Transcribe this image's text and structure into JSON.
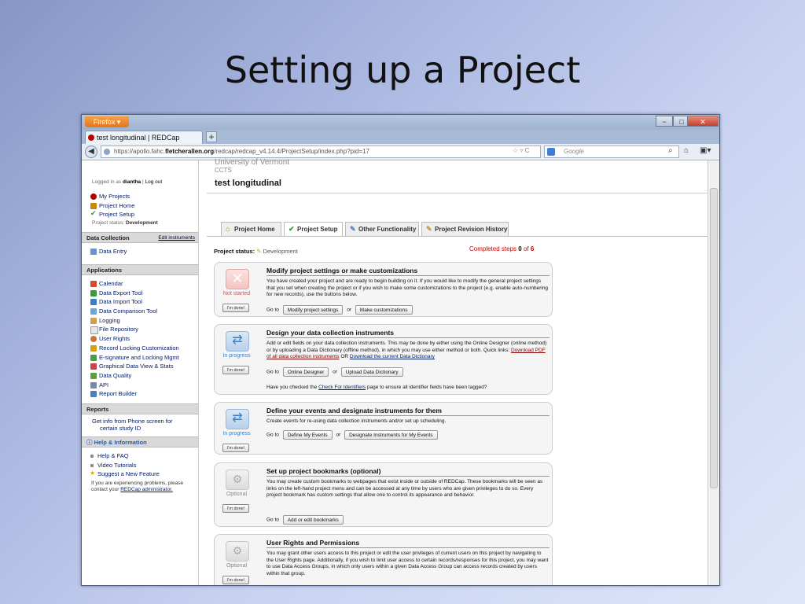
{
  "slide": {
    "title": "Setting up a Project"
  },
  "browser": {
    "menu_button": "Firefox ▾",
    "tab_title": "test longitudinal | REDCap",
    "url_prefix": "https://apollo.fahc.",
    "url_domain": "fletcherallen.org",
    "url_suffix": "/redcap/redcap_v4.14.4/ProjectSetup/index.php?pid=17",
    "search_placeholder": "Google",
    "minimize": "−",
    "maximize": "□",
    "close": "✕"
  },
  "sidebar": {
    "logged_in_prefix": "Logged in as",
    "username": "diantha",
    "logout": "Log out",
    "links": [
      {
        "label": "My Projects",
        "color": "#b00000"
      },
      {
        "label": "Project Home",
        "color": "#cc8800"
      },
      {
        "label": "Project Setup",
        "color": "#2e9e2e"
      }
    ],
    "status_label": "Project status:",
    "status_value": "Development",
    "data_collection": {
      "title": "Data Collection",
      "edit_link": "Edit instruments",
      "items": [
        "Data Entry"
      ]
    },
    "applications": {
      "title": "Applications",
      "items": [
        "Calendar",
        "Data Export Tool",
        "Data Import Tool",
        "Data Comparison Tool",
        "Logging",
        "File Repository",
        "User Rights",
        "Record Locking Customization",
        "E-signature and Locking Mgmt",
        "Graphical Data View & Stats",
        "Data Quality",
        "API",
        "Report Builder"
      ]
    },
    "reports": {
      "title": "Reports",
      "item_line1": "Get info from Phone screen for",
      "item_line2": "certain study ID"
    },
    "help": {
      "title": "Help & Information",
      "items": [
        "Help & FAQ",
        "Video Tutorials",
        "Suggest a New Feature"
      ],
      "note_line1": "If you are experiencing problems, please",
      "note_line2_prefix": "contact your",
      "note_link": "REDCap administrator."
    }
  },
  "main": {
    "institution": "University of Vermont",
    "dept": "CCTS",
    "project_title": "test longitudinal",
    "tabs": [
      "Project Home",
      "Project Setup",
      "Other Functionality",
      "Project Revision History"
    ],
    "status_label": "Project status:",
    "status_value": "Development",
    "completed_prefix": "Completed steps",
    "completed_done": "0",
    "completed_of": "of",
    "completed_total": "6",
    "goto": "Go to",
    "or": "or",
    "done_btn": "I'm done!",
    "steps": [
      {
        "title": "Modify project settings or make customizations",
        "state": "Not started",
        "desc": "You have created your project and are ready to begin building on it. If you would like to modify the general project settings that you set when creating the project or if you wish to make some customizations to the project (e.g. enable auto-numbering for new records), use the buttons below.",
        "btn1": "Modify project settings",
        "btn2": "Make customizations"
      },
      {
        "title": "Design your data collection instruments",
        "state": "In progress",
        "desc": "Add or edit fields on your data collection instruments. This may be done by either using the Online Designer (online method) or by uploading a Data Dictionary (offline method), in which you may use either method or both. Quick links:",
        "link1": "Download PDF of all data collection instruments",
        "link_or": "OR",
        "link2": "Download the current Data Dictionary",
        "btn1": "Online Designer",
        "btn2": "Upload Data Dictionary",
        "check_prefix": "Have you checked the",
        "check_link": "Check For Identifiers",
        "check_suffix": "page to ensure all identifier fields have been tagged?"
      },
      {
        "title": "Define your events and designate instruments for them",
        "state": "In progress",
        "desc": "Create events for re-using data collection instruments and/or set up scheduling.",
        "btn1": "Define My Events",
        "btn2": "Designate Instruments for My Events"
      },
      {
        "title": "Set up project bookmarks (optional)",
        "state": "Optional",
        "desc": "You may create custom bookmarks to webpages that exist inside or outside of REDCap. These bookmarks will be seen as links on the left-hand project menu and can be accessed at any time by users who are given privileges to do so. Every project bookmark has custom settings that allow one to control its appearance and behavior.",
        "btn1": "Add or edit bookmarks"
      },
      {
        "title": "User Rights and Permissions",
        "state": "Optional",
        "desc": "You may grant other users access to this project or edit the user privileges of current users on this project by navigating to the User Rights page. Additionally, if you wish to limit user access to certain records/responses for this project, you may want to use Data Access Groups, in which only users within a given Data Access Group can access records created by users within that group."
      }
    ]
  },
  "colors": {
    "not_started": "#d9534f",
    "in_progress": "#3a7fc4",
    "optional": "#888888"
  }
}
